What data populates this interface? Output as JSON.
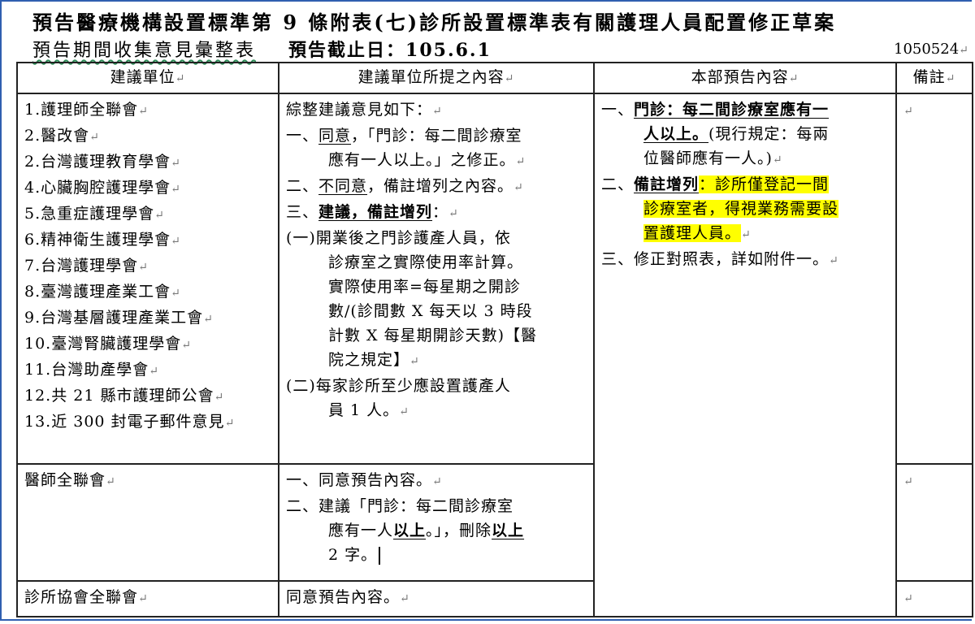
{
  "document": {
    "title_line1": "預告醫療機構設置標準第 9 條附表(七)診所設置標準表有關護理人員配置修正草案",
    "title_line2": "預告期間收集意見彙整表",
    "deadline": "預告截止日：105.6.1",
    "doc_number": "1050524"
  },
  "table": {
    "headers": [
      "建議單位",
      "建議單位所提之內容",
      "本部預告內容",
      "備註"
    ],
    "row1": {
      "units": [
        "1.護理師全聯會",
        "2.醫改會",
        "2.台灣護理教育學會",
        "4.心臟胸腔護理學會",
        "5.急重症護理學會",
        "6.精神衛生護理學會",
        "7.台灣護理學會",
        "8.臺灣護理產業工會",
        "9.台灣基層護理產業工會",
        "10.臺灣腎臟護理學會",
        "11.台灣助產學會",
        "12.共 21 縣市護理師公會",
        "13.近 300 封電子郵件意見"
      ],
      "content": {
        "intro": "綜整建議意見如下：",
        "p1_lead": "一、",
        "p1_head": "同意",
        "p1_rest": "，「門診：每二間診療室",
        "p1_cont": "應有一人以上。」之修正。",
        "p2_lead": "二、",
        "p2_head": "不同意",
        "p2_rest": "，備註增列之內容。",
        "p3_lead": "三、",
        "p3_head": "建議，備註增列",
        "p3_rest": "：",
        "s1_first": "(一)開業後之門診護產人員，依",
        "s1_lines": [
          "診療室之實際使用率計算。",
          "實際使用率=每星期之開診",
          "數/(診間數 X 每天以 3 時段",
          "計數 X 每星期開診天數)【醫",
          "院之規定】"
        ],
        "s2_first": "(二)每家診所至少應設置護產人",
        "s2_cont": "員 1 人。"
      },
      "announce": {
        "a1_lead": "一、",
        "a1_head": "門診：每二間診療室應有一",
        "a1_line2_head": "人以上。",
        "a1_line2_rest": "(現行規定：每兩",
        "a1_line3": "位醫師應有一人。)",
        "a2_lead": "二、",
        "a2_head": "備註增列",
        "a2_colon": "：",
        "a2_hl1": "診所僅登記一間",
        "a2_hl2": "診療室者，得視業務需要設",
        "a2_hl3": "置護理人員。",
        "a3": "三、修正對照表，詳如附件一。"
      }
    },
    "row2": {
      "unit": "醫師全聯會",
      "c1": "一、同意預告內容。",
      "c2": "二、建議「門診：每二間診療室",
      "c3_a": "應有一人",
      "c3_b": "以上",
      "c3_c": "。」，刪除",
      "c3_d": "以上",
      "c4": "2 字。"
    },
    "row3": {
      "unit": "診所協會全聯會",
      "content": "同意預告內容。"
    },
    "para_mark": "↵"
  }
}
